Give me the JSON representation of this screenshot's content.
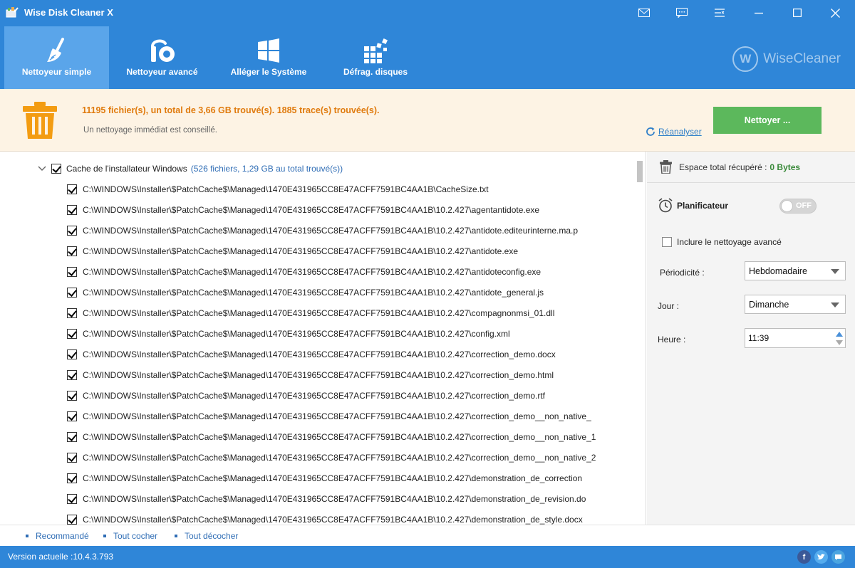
{
  "app": {
    "title": "Wise Disk Cleaner X",
    "brand": "WiseCleaner",
    "brand_letter": "W"
  },
  "nav": {
    "tabs": [
      {
        "label": "Nettoyeur simple",
        "icon": "broom-icon",
        "active": true
      },
      {
        "label": "Nettoyeur avancé",
        "icon": "vacuum-icon",
        "active": false
      },
      {
        "label": "Alléger le Système",
        "icon": "windows-icon",
        "active": false
      },
      {
        "label": "Défrag. disques",
        "icon": "defrag-icon",
        "active": false
      }
    ]
  },
  "summary": {
    "found": "11195 fichier(s), un total de 3,66 GB trouvé(s). 1885 trace(s) trouvée(s).",
    "advice": "Un nettoyage immédiat est conseillé.",
    "reanalyze": "Réanalyser",
    "clean_button": "Nettoyer ..."
  },
  "list": {
    "group": {
      "name": "Cache de l'installateur Windows",
      "count": "(526 fichiers, 1,29 GB au total trouvé(s))",
      "checked": true
    },
    "files": [
      "C:\\WINDOWS\\Installer\\$PatchCache$\\Managed\\1470E431965CC8E47ACFF7591BC4AA1B\\CacheSize.txt",
      "C:\\WINDOWS\\Installer\\$PatchCache$\\Managed\\1470E431965CC8E47ACFF7591BC4AA1B\\10.2.427\\agentantidote.exe",
      "C:\\WINDOWS\\Installer\\$PatchCache$\\Managed\\1470E431965CC8E47ACFF7591BC4AA1B\\10.2.427\\antidote.editeurinterne.ma.p",
      "C:\\WINDOWS\\Installer\\$PatchCache$\\Managed\\1470E431965CC8E47ACFF7591BC4AA1B\\10.2.427\\antidote.exe",
      "C:\\WINDOWS\\Installer\\$PatchCache$\\Managed\\1470E431965CC8E47ACFF7591BC4AA1B\\10.2.427\\antidoteconfig.exe",
      "C:\\WINDOWS\\Installer\\$PatchCache$\\Managed\\1470E431965CC8E47ACFF7591BC4AA1B\\10.2.427\\antidote_general.js",
      "C:\\WINDOWS\\Installer\\$PatchCache$\\Managed\\1470E431965CC8E47ACFF7591BC4AA1B\\10.2.427\\compagnonmsi_01.dll",
      "C:\\WINDOWS\\Installer\\$PatchCache$\\Managed\\1470E431965CC8E47ACFF7591BC4AA1B\\10.2.427\\config.xml",
      "C:\\WINDOWS\\Installer\\$PatchCache$\\Managed\\1470E431965CC8E47ACFF7591BC4AA1B\\10.2.427\\correction_demo.docx",
      "C:\\WINDOWS\\Installer\\$PatchCache$\\Managed\\1470E431965CC8E47ACFF7591BC4AA1B\\10.2.427\\correction_demo.html",
      "C:\\WINDOWS\\Installer\\$PatchCache$\\Managed\\1470E431965CC8E47ACFF7591BC4AA1B\\10.2.427\\correction_demo.rtf",
      "C:\\WINDOWS\\Installer\\$PatchCache$\\Managed\\1470E431965CC8E47ACFF7591BC4AA1B\\10.2.427\\correction_demo__non_native_",
      "C:\\WINDOWS\\Installer\\$PatchCache$\\Managed\\1470E431965CC8E47ACFF7591BC4AA1B\\10.2.427\\correction_demo__non_native_1",
      "C:\\WINDOWS\\Installer\\$PatchCache$\\Managed\\1470E431965CC8E47ACFF7591BC4AA1B\\10.2.427\\correction_demo__non_native_2",
      "C:\\WINDOWS\\Installer\\$PatchCache$\\Managed\\1470E431965CC8E47ACFF7591BC4AA1B\\10.2.427\\demonstration_de_correction",
      "C:\\WINDOWS\\Installer\\$PatchCache$\\Managed\\1470E431965CC8E47ACFF7591BC4AA1B\\10.2.427\\demonstration_de_revision.do",
      "C:\\WINDOWS\\Installer\\$PatchCache$\\Managed\\1470E431965CC8E47ACFF7591BC4AA1B\\10.2.427\\demonstration_de_style.docx"
    ]
  },
  "side": {
    "space_label": "Espace total récupéré :",
    "space_value": "0 Bytes",
    "scheduler_title": "Planificateur",
    "toggle_label": "OFF",
    "include_advanced": "Inclure le nettoyage avancé",
    "periodicity_label": "Périodicité :",
    "periodicity_value": "Hebdomadaire",
    "day_label": "Jour :",
    "day_value": "Dimanche",
    "time_label": "Heure :",
    "time_value": "11:39"
  },
  "footer": {
    "recommended": "Recommandé",
    "check_all": "Tout cocher",
    "uncheck_all": "Tout décocher"
  },
  "status": {
    "version": "Version actuelle :10.4.3.793",
    "social": [
      "facebook-icon",
      "twitter-icon",
      "feedback-icon"
    ]
  },
  "colors": {
    "header_blue": "#2f86d8",
    "active_tab": "#5aa5ea",
    "summary_orange": "#e07b0e",
    "clean_green": "#5cb85c",
    "banner_bg": "#fdf3e4"
  }
}
